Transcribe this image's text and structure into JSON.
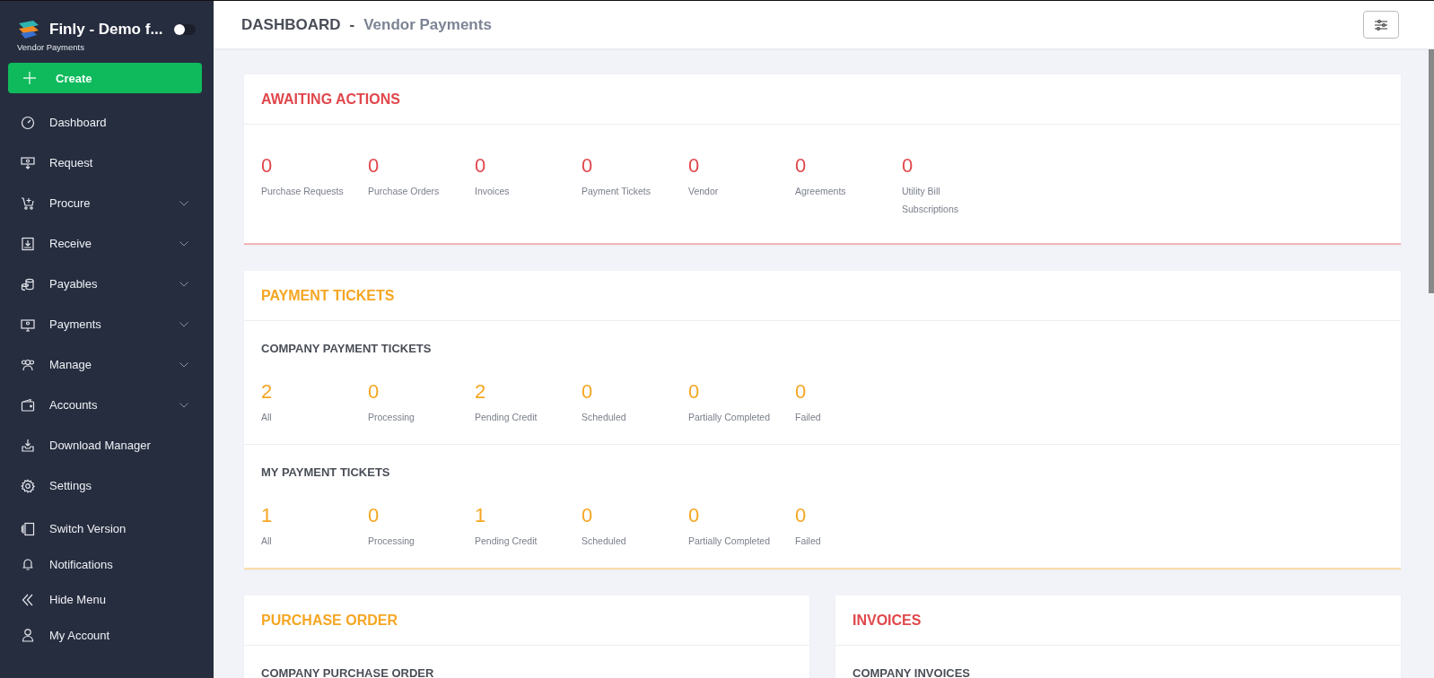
{
  "sidebar": {
    "brand": "Finly - Demo f...",
    "subtitle": "Vendor Payments",
    "theme_toggle": {
      "on": false
    },
    "create_button": "Create",
    "nav_items": [
      {
        "label": "Dashboard",
        "expandable": false
      },
      {
        "label": "Request",
        "expandable": false
      },
      {
        "label": "Procure",
        "expandable": true
      },
      {
        "label": "Receive",
        "expandable": true
      },
      {
        "label": "Payables",
        "expandable": true
      },
      {
        "label": "Payments",
        "expandable": true
      },
      {
        "label": "Manage",
        "expandable": true
      },
      {
        "label": "Accounts",
        "expandable": true
      },
      {
        "label": "Download Manager",
        "expandable": false
      },
      {
        "label": "Settings",
        "expandable": false
      }
    ],
    "footer_items": [
      {
        "label": "Switch Version"
      },
      {
        "label": "Notifications"
      },
      {
        "label": "Hide Menu"
      },
      {
        "label": "My Account"
      }
    ]
  },
  "header": {
    "title": "DASHBOARD",
    "separator": "-",
    "subtitle": "Vendor Payments"
  },
  "sections": [
    {
      "kind": "full",
      "title": "AWAITING ACTIONS",
      "color": "#e0474c",
      "groups": [
        {
          "stats": [
            {
              "value": "0",
              "label": "Purchase Requests"
            },
            {
              "value": "0",
              "label": "Purchase Orders"
            },
            {
              "value": "0",
              "label": "Invoices"
            },
            {
              "value": "0",
              "label": "Payment Tickets"
            },
            {
              "value": "0",
              "label": "Vendor"
            },
            {
              "value": "0",
              "label": "Agreements"
            },
            {
              "value": "0",
              "label": "Utility Bill Subscriptions"
            }
          ]
        }
      ]
    },
    {
      "kind": "full",
      "title": "PAYMENT TICKETS",
      "color": "#f5a623",
      "groups": [
        {
          "title": "COMPANY PAYMENT TICKETS",
          "stats": [
            {
              "value": "2",
              "label": "All"
            },
            {
              "value": "0",
              "label": "Processing"
            },
            {
              "value": "2",
              "label": "Pending Credit"
            },
            {
              "value": "0",
              "label": "Scheduled"
            },
            {
              "value": "0",
              "label": "Partially Completed"
            },
            {
              "value": "0",
              "label": "Failed"
            }
          ]
        },
        {
          "title": "MY PAYMENT TICKETS",
          "stats": [
            {
              "value": "1",
              "label": "All"
            },
            {
              "value": "0",
              "label": "Processing"
            },
            {
              "value": "1",
              "label": "Pending Credit"
            },
            {
              "value": "0",
              "label": "Scheduled"
            },
            {
              "value": "0",
              "label": "Partially Completed"
            },
            {
              "value": "0",
              "label": "Failed"
            }
          ]
        }
      ]
    },
    {
      "kind": "half",
      "title": "PURCHASE ORDER",
      "color": "#f5a623",
      "groups": [
        {
          "title": "COMPANY PURCHASE ORDER"
        }
      ]
    },
    {
      "kind": "half",
      "title": "INVOICES",
      "color": "#e0474c",
      "groups": [
        {
          "title": "COMPANY INVOICES"
        }
      ]
    }
  ]
}
